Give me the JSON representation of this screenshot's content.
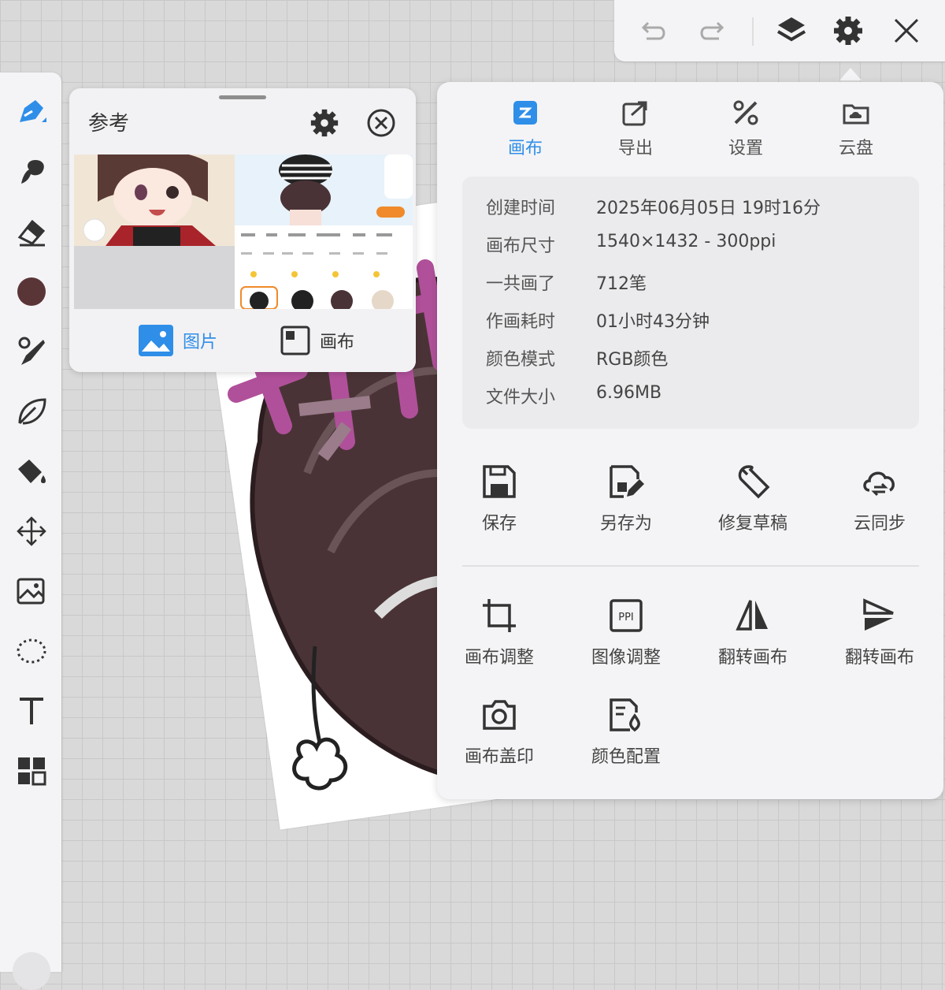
{
  "topbar": {
    "undo_icon": "undo-icon",
    "redo_icon": "redo-icon",
    "layers_icon": "layers-icon",
    "settings_icon": "gear-icon",
    "close_icon": "close-icon"
  },
  "toolbar": {
    "tools": [
      "brush-tool",
      "smudge-tool",
      "eraser-tool",
      "color-swatch",
      "brush-settings-tool",
      "leaf-tool",
      "fill-bucket-tool",
      "transform-tool",
      "image-import-tool",
      "lasso-select-tool",
      "text-tool",
      "apps-grid-tool"
    ],
    "current_color": "#5a3537"
  },
  "reference": {
    "title": "参考",
    "tab_image": "图片",
    "tab_canvas": "画布",
    "active_color": "#2f8ee8"
  },
  "menu": {
    "tabs": [
      {
        "label": "画布",
        "active": true
      },
      {
        "label": "导出",
        "active": false
      },
      {
        "label": "设置",
        "active": false
      },
      {
        "label": "云盘",
        "active": false
      }
    ],
    "info": [
      {
        "key": "创建时间",
        "value": "2025年06月05日 19时16分"
      },
      {
        "key": "画布尺寸",
        "value": "1540×1432 - 300ppi"
      },
      {
        "key": "一共画了",
        "value": "712笔"
      },
      {
        "key": "作画耗时",
        "value": "01小时43分钟"
      },
      {
        "key": "颜色模式",
        "value": "RGB颜色"
      },
      {
        "key": "文件大小",
        "value": "6.96MB"
      }
    ],
    "actions_row1": [
      {
        "label": "保存",
        "icon": "save-icon"
      },
      {
        "label": "另存为",
        "icon": "save-as-icon"
      },
      {
        "label": "修复草稿",
        "icon": "wrench-icon"
      },
      {
        "label": "云同步",
        "icon": "cloud-sync-icon"
      }
    ],
    "actions_row2": [
      {
        "label": "画布调整",
        "icon": "crop-icon"
      },
      {
        "label": "图像调整",
        "icon": "ppi-icon"
      },
      {
        "label": "翻转画布",
        "icon": "flip-horizontal-icon"
      },
      {
        "label": "翻转画布",
        "icon": "flip-vertical-icon"
      }
    ],
    "actions_row3": [
      {
        "label": "画布盖印",
        "icon": "camera-stamp-icon"
      },
      {
        "label": "颜色配置",
        "icon": "color-profile-icon"
      }
    ]
  }
}
